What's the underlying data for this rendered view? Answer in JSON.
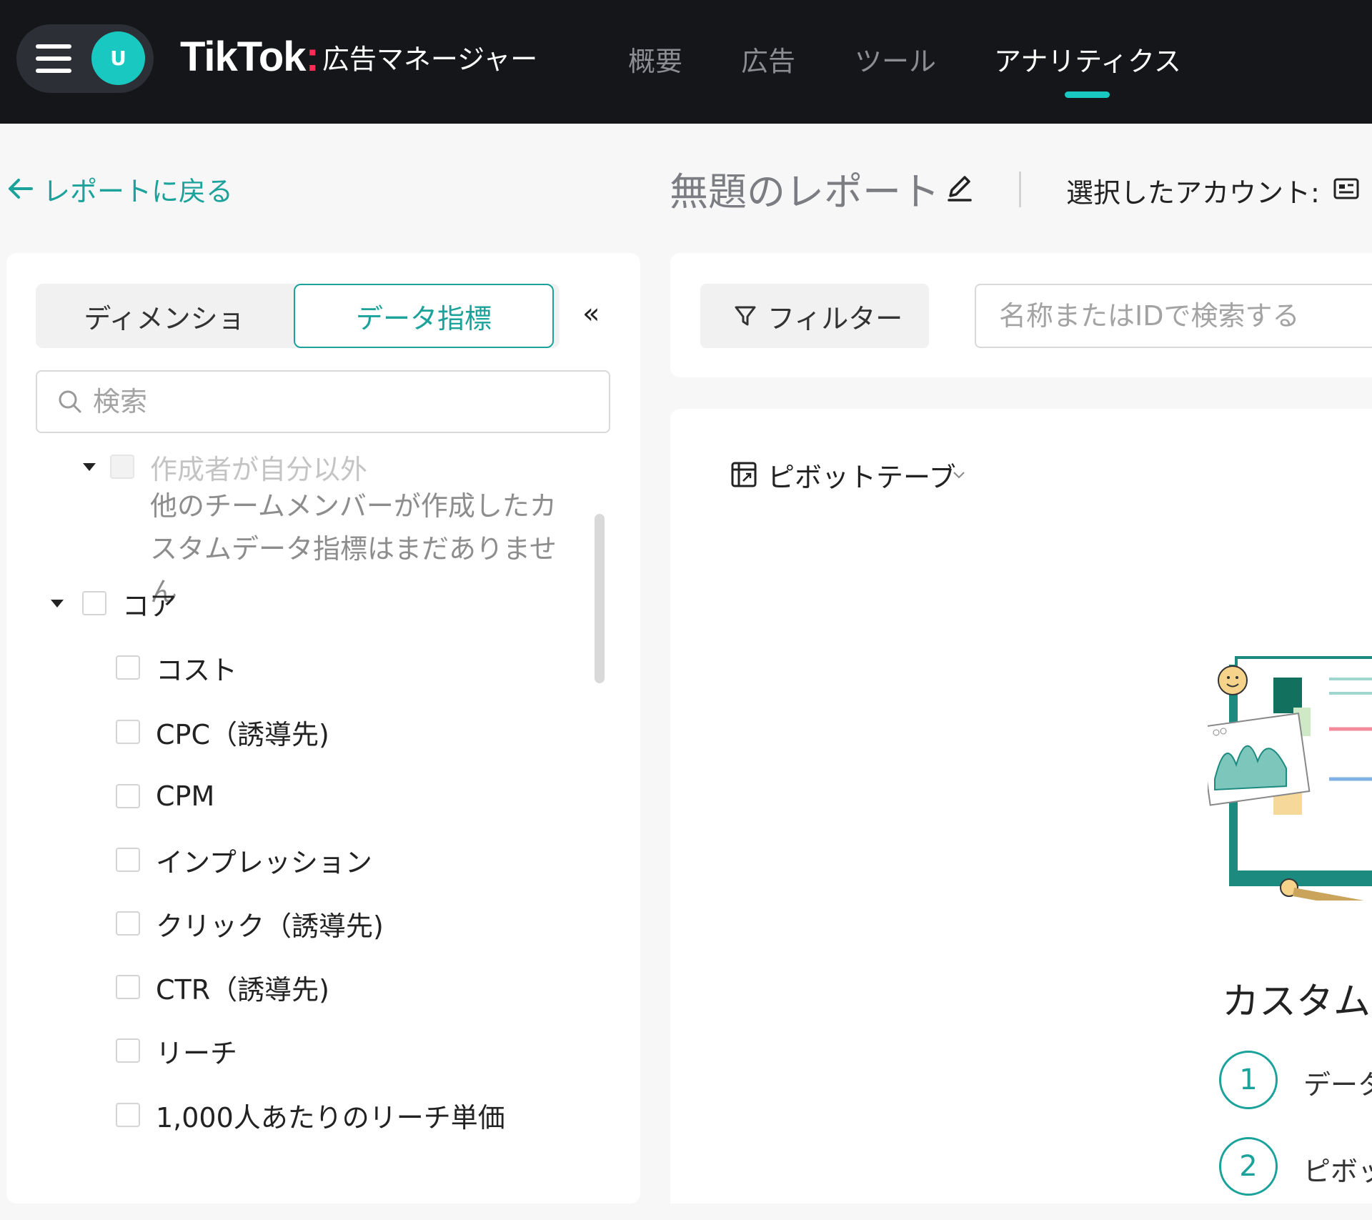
{
  "header": {
    "avatar_initial": "U",
    "brand_name": "TikTok",
    "brand_product": "広告マネージャー",
    "nav": [
      "概要",
      "広告",
      "ツール",
      "アナリティクス"
    ],
    "active_nav": "アナリティクス",
    "accent_color": "#19c9c1"
  },
  "subheader": {
    "back_label": "レポートに戻る",
    "report_title": "無題のレポート",
    "account_label": "選択したアカウント:"
  },
  "left_panel": {
    "tab_dimensions": "ディメンショ",
    "tab_metrics": "データ指標",
    "collapse_symbol": "«",
    "search_placeholder": "検索",
    "group_custom_other": "作成者が自分以外",
    "custom_empty_note": "他のチームメンバーが作成したカスタムデータ指標はまだありません",
    "group_core": "コア",
    "core_items": [
      "コスト",
      "CPC（誘導先)",
      "CPM",
      "インプレッション",
      "クリック（誘導先)",
      "CTR（誘導先)",
      "リーチ",
      "1,000人あたりのリーチ単価"
    ]
  },
  "toolbar": {
    "filter_label": "フィルター",
    "name_search_placeholder": "名称またはIDで検索する"
  },
  "main": {
    "pivot_label": "ピボットテーブ",
    "custom_heading": "カスタム",
    "steps": [
      {
        "number": "1",
        "text": "データ"
      },
      {
        "number": "2",
        "text": "ピボッ"
      }
    ]
  }
}
